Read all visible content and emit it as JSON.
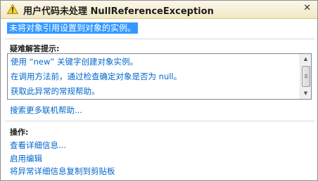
{
  "title": "用户代码未处理 NullReferenceException",
  "message": "未将对象引用设置到对象的实例。",
  "troubleshooting": {
    "heading": "疑难解答提示:",
    "tips": [
      "使用 “new” 关键字创建对象实例。",
      "在调用方法前，通过检查确定对象是否为 null。",
      "获取此异常的常规帮助。"
    ],
    "search_link": "搜索更多联机帮助..."
  },
  "actions": {
    "heading": "操作:",
    "items": [
      "查看详细信息...",
      "启用编辑",
      "将异常详细信息复制到剪贴板"
    ]
  },
  "colors": {
    "link": "#0066cc",
    "selection": "#3399ff",
    "title_bar": "#f4edd2"
  },
  "icons": [
    "warning-icon",
    "close-icon",
    "scroll-up-icon",
    "scroll-down-icon"
  ]
}
